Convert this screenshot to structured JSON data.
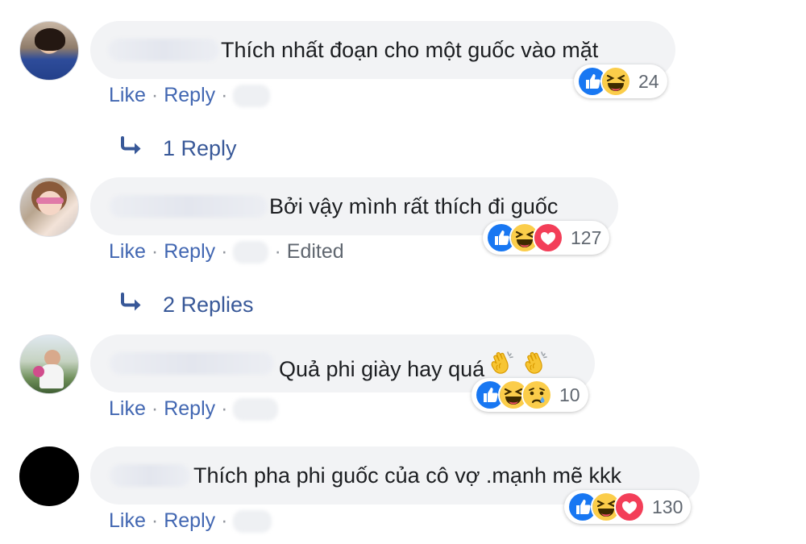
{
  "labels": {
    "like": "Like",
    "reply": "Reply",
    "sep": "·"
  },
  "comments": [
    {
      "text": "Thích nhất đoạn cho một guốc vào mặt",
      "reaction_count": "24",
      "meta": "",
      "replies_label": "1 Reply"
    },
    {
      "text": "Bởi vậy mình rất thích đi guốc",
      "reaction_count": "127",
      "meta": "Edited",
      "replies_label": "2 Replies"
    },
    {
      "text": "Quả phi giày hay quá",
      "reaction_count": "10",
      "meta": "",
      "replies_label": ""
    },
    {
      "text": "Thích pha phi guốc của cô vợ .mạnh mẽ kkk",
      "reaction_count": "130",
      "meta": "",
      "replies_label": ""
    }
  ],
  "icons": {
    "like": "like-reaction-icon",
    "haha": "haha-reaction-icon",
    "love": "love-reaction-icon",
    "sad": "sad-reaction-icon",
    "reply_arrow": "reply-arrow-icon",
    "clap": "clapping-hands-emoji"
  },
  "colors": {
    "link": "#4267b2",
    "bubble": "#f2f3f5",
    "like_blue": "#1877f2",
    "love_red": "#f33e58",
    "haha_yellow": "#fbcd4a"
  }
}
